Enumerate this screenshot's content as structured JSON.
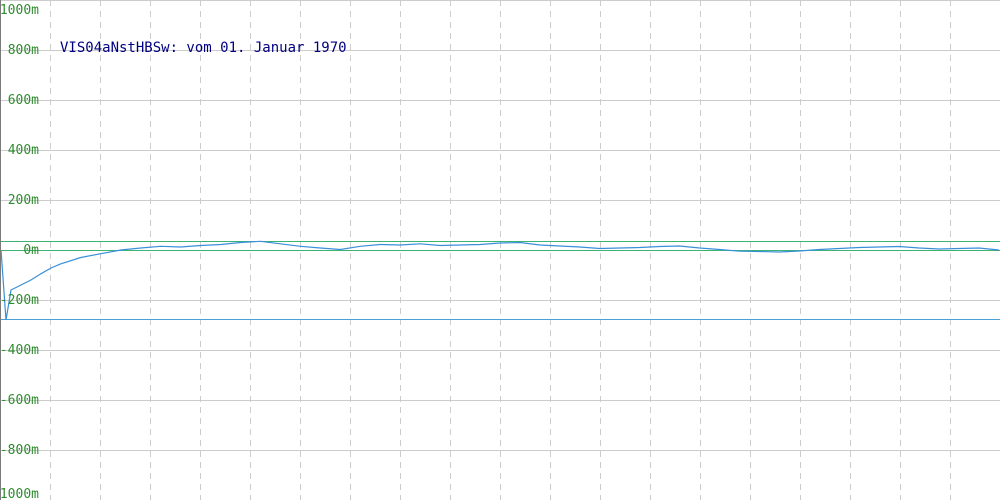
{
  "chart_data": {
    "type": "line",
    "title": "VIS04aNstHBSw: vom 01. Januar 1970",
    "xlabel": "",
    "ylabel": "",
    "ylim": [
      -1000,
      1000
    ],
    "y_unit": "m",
    "y_ticks": [
      1000,
      800,
      600,
      400,
      200,
      0,
      -200,
      -400,
      -600,
      -800,
      -1000
    ],
    "y_tick_labels": [
      "1000m",
      "800m",
      "600m",
      "400m",
      "200m",
      "0m",
      "-200m",
      "-400m",
      "-600m",
      "-800m",
      "-1000m"
    ],
    "x_gridlines": 20,
    "grid": {
      "horizontal": "solid",
      "vertical": "dashed"
    },
    "reference_lines": [
      {
        "value": 35,
        "color": "#3cb371"
      },
      {
        "value": 0,
        "color": "#3cb371"
      },
      {
        "value": -275,
        "color": "#4a9fd8"
      }
    ],
    "series": [
      {
        "color": "#3a8fd9",
        "x": [
          0,
          0.5,
          1,
          1.5,
          2,
          3,
          4,
          5,
          6,
          8,
          10,
          12,
          14,
          16,
          18,
          20,
          22,
          24,
          26,
          28,
          30,
          32,
          34,
          36,
          38,
          40,
          42,
          44,
          46,
          48,
          50,
          52,
          54,
          56,
          58,
          60,
          62,
          64,
          66,
          68,
          70,
          72,
          74,
          76,
          78,
          80,
          82,
          84,
          86,
          88,
          90,
          92,
          94,
          96,
          98,
          100
        ],
        "values": [
          0,
          -280,
          -160,
          -150,
          -140,
          -120,
          -95,
          -72,
          -55,
          -30,
          -15,
          0,
          8,
          15,
          12,
          18,
          22,
          30,
          35,
          25,
          15,
          8,
          2,
          15,
          22,
          20,
          25,
          18,
          20,
          22,
          28,
          30,
          20,
          16,
          12,
          6,
          8,
          10,
          14,
          16,
          8,
          2,
          -5,
          -6,
          -8,
          -4,
          2,
          6,
          10,
          12,
          14,
          8,
          4,
          6,
          8,
          0
        ]
      }
    ],
    "colors": {
      "axis_labels": "#2e8b2e",
      "title": "#000080",
      "grid": "#cccccc",
      "series": "#3a8fd9"
    }
  }
}
